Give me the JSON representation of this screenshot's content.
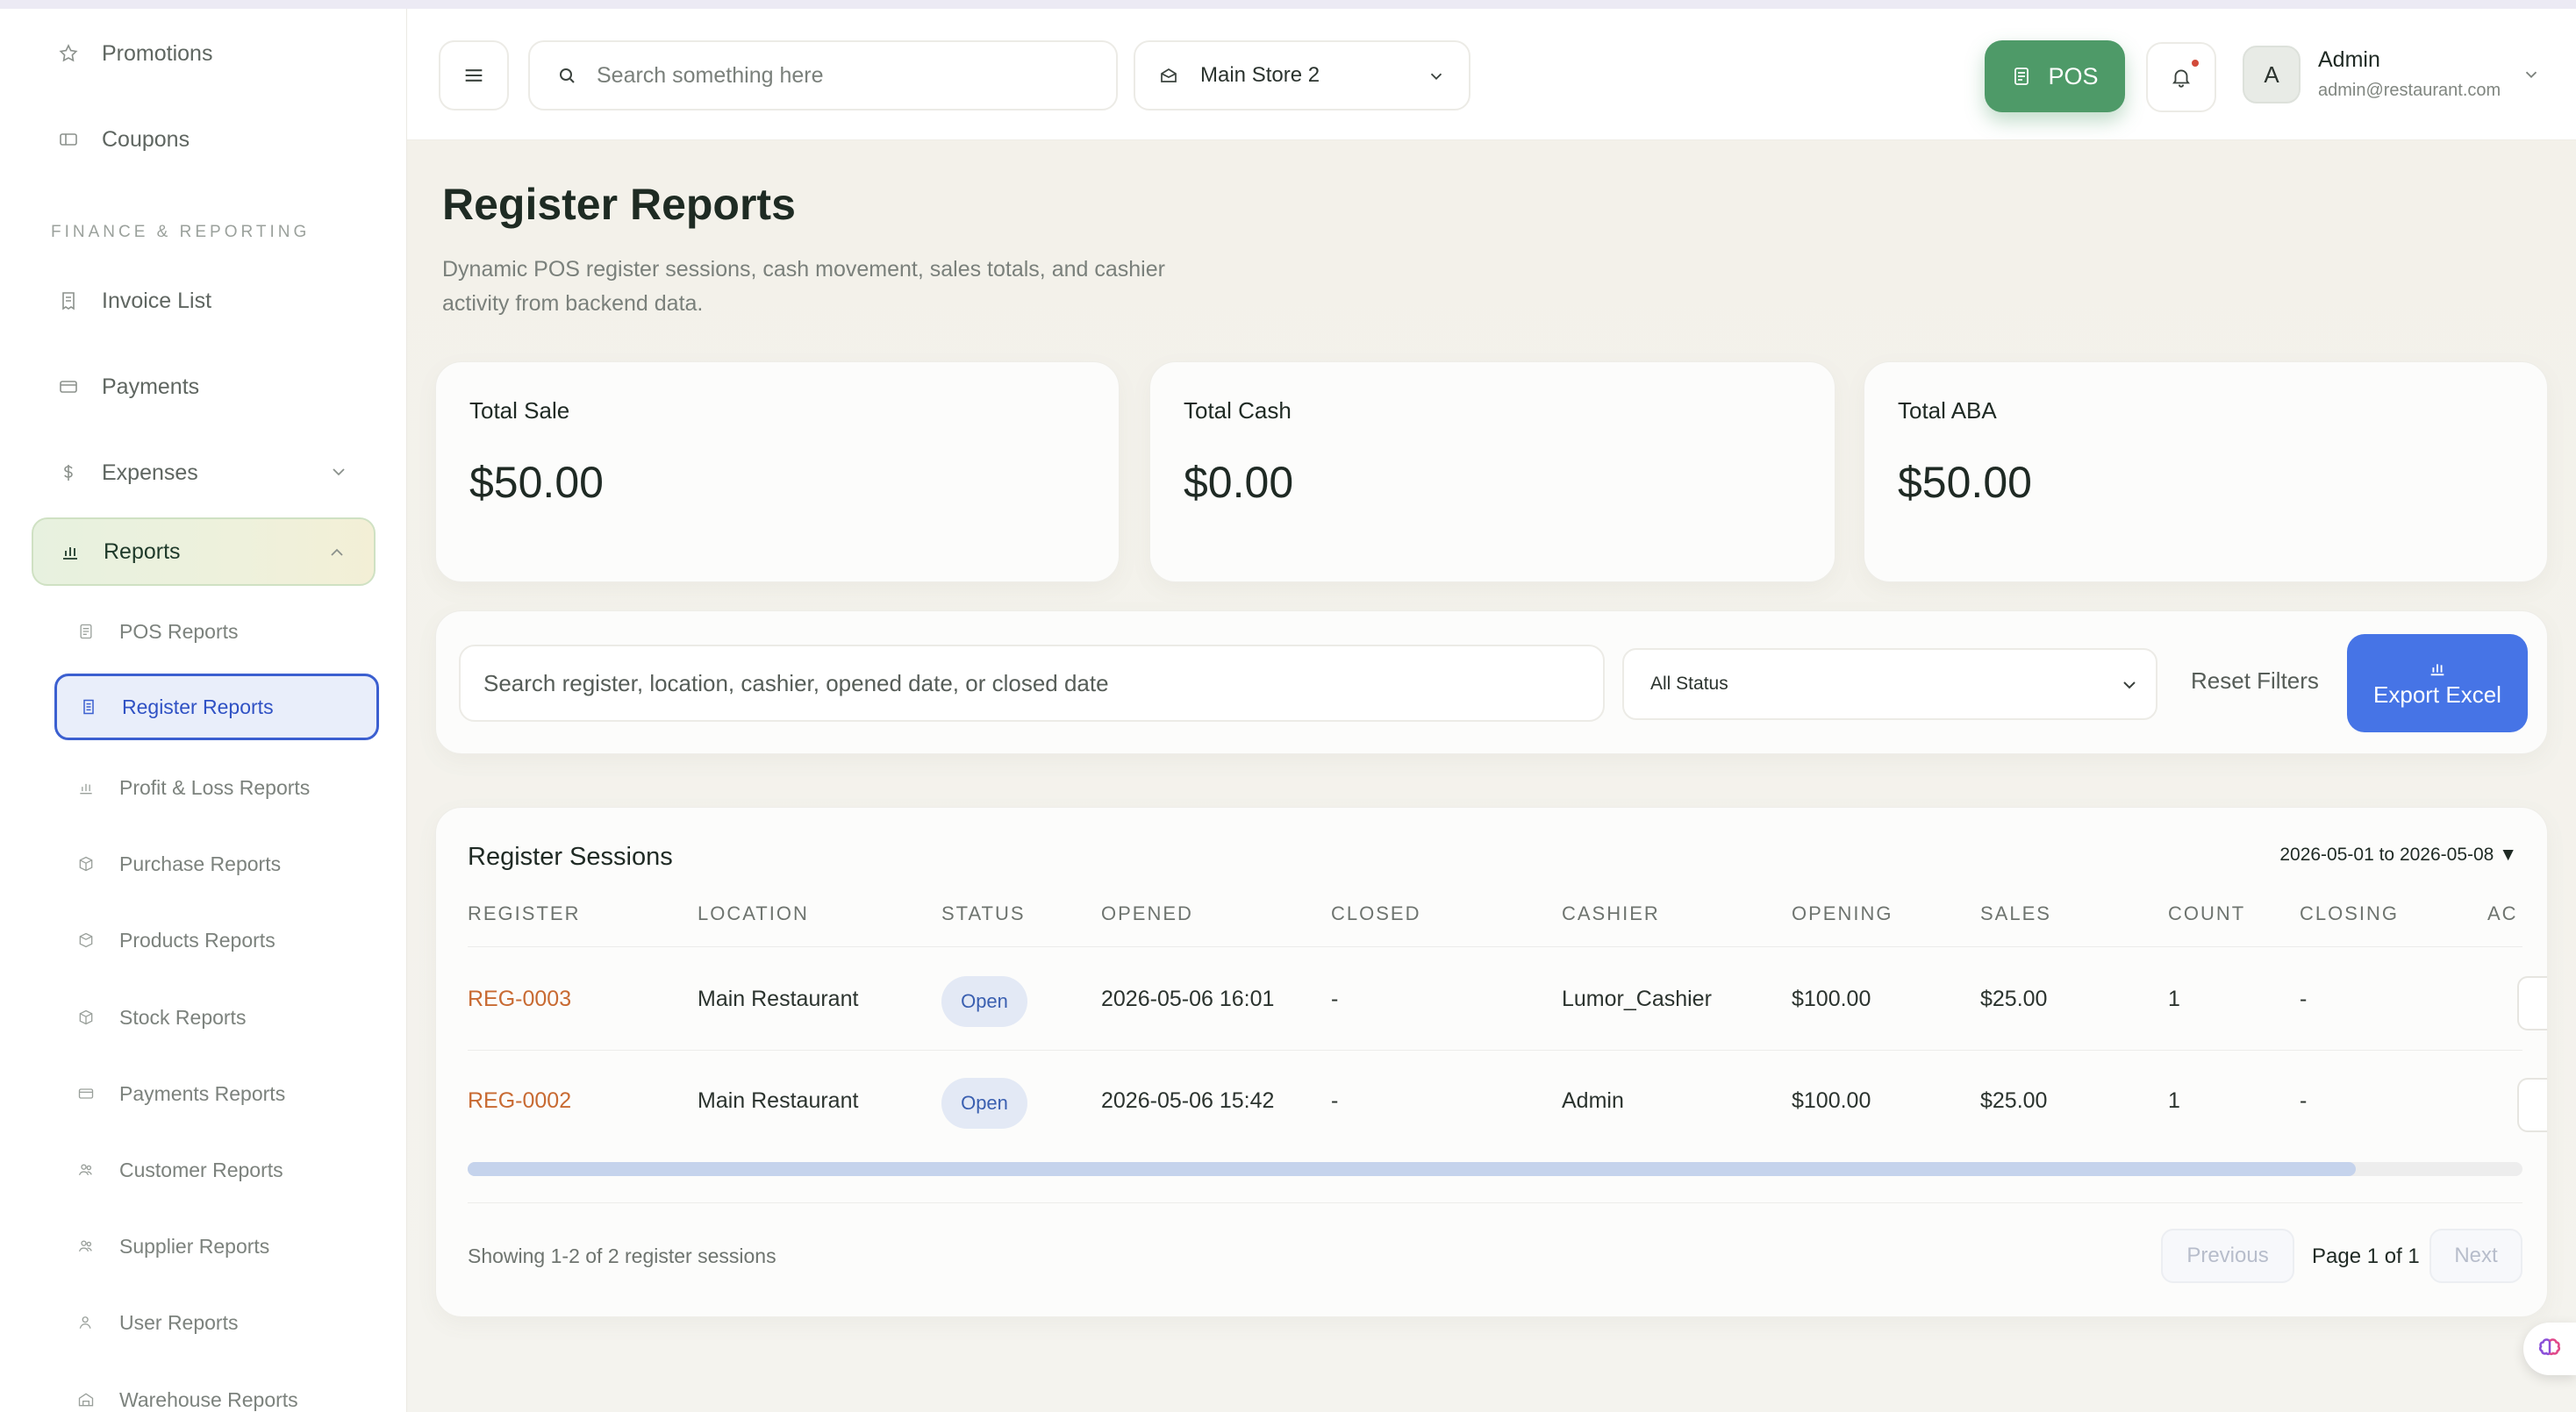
{
  "sidebar": {
    "items": [
      {
        "label": "Promotions",
        "icon": "star-icon"
      },
      {
        "label": "Coupons",
        "icon": "ticket-icon"
      }
    ],
    "section_label": "FINANCE & REPORTING",
    "finance_items": [
      {
        "label": "Invoice List",
        "icon": "receipt-icon"
      },
      {
        "label": "Payments",
        "icon": "card-icon"
      },
      {
        "label": "Expenses",
        "icon": "dollar-icon"
      },
      {
        "label": "Reports",
        "icon": "bar-chart-icon"
      }
    ],
    "report_items": [
      {
        "label": "POS Reports"
      },
      {
        "label": "Register Reports"
      },
      {
        "label": "Profit & Loss Reports"
      },
      {
        "label": "Purchase Reports"
      },
      {
        "label": "Products Reports"
      },
      {
        "label": "Stock Reports"
      },
      {
        "label": "Payments Reports"
      },
      {
        "label": "Customer Reports"
      },
      {
        "label": "Supplier Reports"
      },
      {
        "label": "User Reports"
      },
      {
        "label": "Warehouse Reports"
      }
    ]
  },
  "header": {
    "search_placeholder": "Search something here",
    "store": "Main Store 2",
    "pos_label": "POS",
    "user_initial": "A",
    "user_name": "Admin",
    "user_email": "admin@restaurant.com"
  },
  "page": {
    "title": "Register Reports",
    "subtitle": "Dynamic POS register sessions, cash movement, sales totals, and cashier activity from backend data."
  },
  "stats": [
    {
      "label": "Total Sale",
      "value": "$50.00"
    },
    {
      "label": "Total Cash",
      "value": "$0.00"
    },
    {
      "label": "Total ABA",
      "value": "$50.00"
    }
  ],
  "filters": {
    "search_placeholder": "Search register, location, cashier, opened date, or closed date",
    "status": "All Status",
    "reset_label": "Reset Filters",
    "export_label": "Export Excel"
  },
  "table": {
    "title": "Register Sessions",
    "date_range": "2026-05-01 to 2026-05-08 ▼",
    "columns": [
      "REGISTER",
      "LOCATION",
      "STATUS",
      "OPENED",
      "CLOSED",
      "CASHIER",
      "OPENING",
      "SALES",
      "COUNT",
      "CLOSING",
      "AC"
    ],
    "rows": [
      {
        "register": "REG-0003",
        "location": "Main Restaurant",
        "status": "Open",
        "opened": "2026-05-06 16:01",
        "closed": "-",
        "cashier": "Lumor_Cashier",
        "opening": "$100.00",
        "sales": "$25.00",
        "count": "1",
        "closing": "-"
      },
      {
        "register": "REG-0002",
        "location": "Main Restaurant",
        "status": "Open",
        "opened": "2026-05-06 15:42",
        "closed": "-",
        "cashier": "Admin",
        "opening": "$100.00",
        "sales": "$25.00",
        "count": "1",
        "closing": "-"
      }
    ],
    "showing": "Showing 1-2 of 2 register sessions",
    "prev_label": "Previous",
    "page_text": "Page 1 of 1",
    "next_label": "Next"
  },
  "colors": {
    "accent_green": "#4e9a68",
    "accent_blue": "#4674e6",
    "link_orange": "#c86a32"
  }
}
